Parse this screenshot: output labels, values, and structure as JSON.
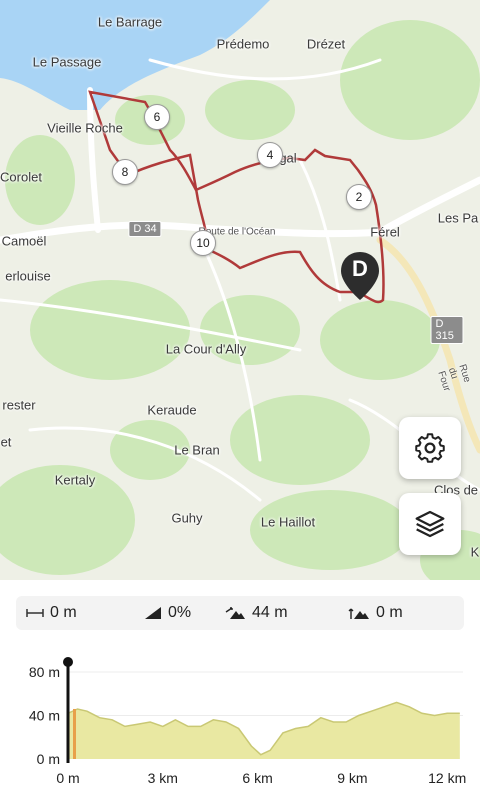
{
  "map": {
    "places": [
      {
        "id": "le-barrage",
        "text": "Le Barrage"
      },
      {
        "id": "predemo",
        "text": "Prédemo"
      },
      {
        "id": "drezet",
        "text": "Drézet"
      },
      {
        "id": "le-passage",
        "text": "Le Passage"
      },
      {
        "id": "vieille-roche",
        "text": "Vieille Roche"
      },
      {
        "id": "corolet",
        "text": "Corolet"
      },
      {
        "id": "camoel",
        "text": "Camoël"
      },
      {
        "id": "ferel",
        "text": "Férel"
      },
      {
        "id": "les-pa",
        "text": "Les Pa"
      },
      {
        "id": "erlouise",
        "text": "erlouise"
      },
      {
        "id": "la-cour",
        "text": "La Cour d'Ally"
      },
      {
        "id": "rester",
        "text": "rester"
      },
      {
        "id": "et",
        "text": "et"
      },
      {
        "id": "keraude",
        "text": "Keraude"
      },
      {
        "id": "le-bran",
        "text": "Le Bran"
      },
      {
        "id": "kertaly",
        "text": "Kertaly"
      },
      {
        "id": "clos-de",
        "text": "Clos de"
      },
      {
        "id": "guhy",
        "text": "Guhy"
      },
      {
        "id": "le-haillot",
        "text": "Le Haillot"
      },
      {
        "id": "k",
        "text": "K"
      },
      {
        "id": "gal",
        "text": "gal"
      }
    ],
    "roads": {
      "d34": "D 34",
      "d315": "D 315",
      "route_ocean": "Route de l'Océan",
      "rue_four": "Rue du Four"
    },
    "km_markers": [
      "2",
      "4",
      "6",
      "8",
      "10"
    ],
    "start_pin_label": "D",
    "colors": {
      "route": "#b03a3a",
      "water": "#a9d4f5",
      "forest": "#cde8b8",
      "road": "#ffffff"
    },
    "buttons": {
      "settings_icon": "gear-icon",
      "layers_icon": "layers-icon"
    }
  },
  "stats": {
    "distance": "0 m",
    "slope": "0%",
    "ascent": "44 m",
    "descent": "0 m"
  },
  "chart_data": {
    "type": "area",
    "title": "",
    "xlabel": "",
    "ylabel": "",
    "x_ticks": [
      "0 m",
      "3 km",
      "6 km",
      "9 km",
      "12 km"
    ],
    "y_ticks": [
      "0 m",
      "40 m",
      "80 m"
    ],
    "xlim": [
      0,
      12.5
    ],
    "ylim": [
      0,
      80
    ],
    "x": [
      0,
      0.3,
      0.6,
      1,
      1.4,
      1.8,
      2.2,
      2.6,
      3,
      3.4,
      3.8,
      4.2,
      4.6,
      5,
      5.4,
      5.8,
      6.1,
      6.4,
      6.8,
      7.2,
      7.6,
      8,
      8.4,
      8.8,
      9.2,
      9.6,
      10,
      10.4,
      10.8,
      11.2,
      11.6,
      12,
      12.4
    ],
    "y": [
      42,
      46,
      44,
      38,
      36,
      30,
      32,
      34,
      30,
      36,
      30,
      30,
      36,
      34,
      28,
      12,
      4,
      8,
      24,
      28,
      30,
      38,
      34,
      34,
      40,
      44,
      48,
      52,
      48,
      42,
      40,
      42,
      42
    ],
    "cursor_x": 0,
    "colors": {
      "fill": "#e9e8a2",
      "line": "#c9c874",
      "cursor": "#111111",
      "marker": "#e8a04a"
    }
  }
}
